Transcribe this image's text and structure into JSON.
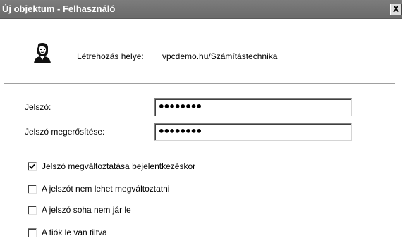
{
  "window": {
    "title": "Új objektum - Felhasználó",
    "close_label": "X"
  },
  "location": {
    "label": "Létrehozás helye:",
    "value": "vpcdemo.hu/Számítástechnika"
  },
  "password": {
    "label": "Jelszó:",
    "masked_value": "••••••••"
  },
  "confirm_password": {
    "label": "Jelszó megerősítése:",
    "masked_value": "••••••••"
  },
  "options": [
    {
      "label": "Jelszó megváltoztatása bejelentkezéskor",
      "checked": true
    },
    {
      "label": "A jelszót nem lehet megváltoztatni",
      "checked": false
    },
    {
      "label": "A jelszó soha nem jár le",
      "checked": false
    },
    {
      "label": "A fiók le van tiltva",
      "checked": false
    }
  ]
}
